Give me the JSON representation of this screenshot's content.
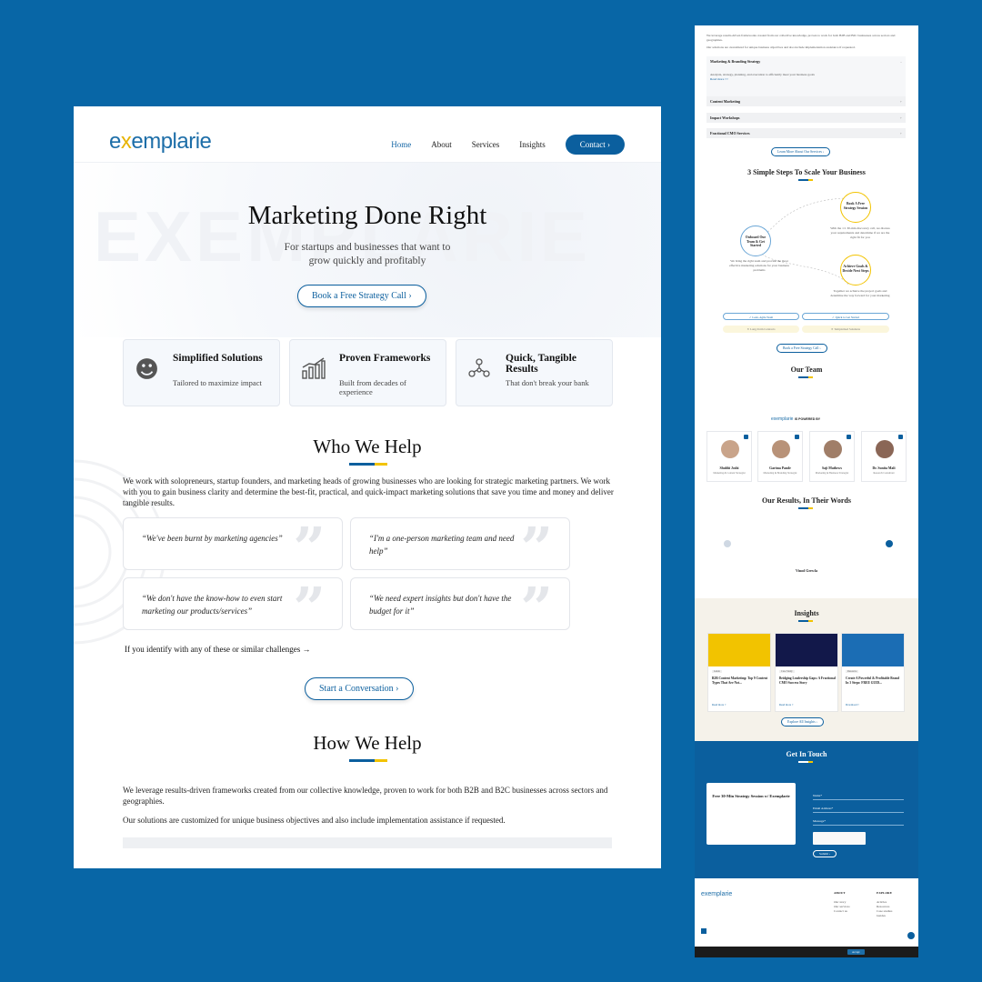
{
  "colors": {
    "background": "#0866a6",
    "brand_blue": "#0b5f9e",
    "accent_yellow": "#f2c300"
  },
  "left": {
    "logo": {
      "text_a": "e",
      "text_b": "x",
      "text_c": "emplarie"
    },
    "nav": {
      "home": "Home",
      "about": "About",
      "services": "Services",
      "insights": "Insights",
      "contact": "Contact"
    },
    "hero": {
      "title": "Marketing Done Right",
      "subtitle_1": "For startups and businesses that want to",
      "subtitle_2": "grow quickly and profitably",
      "cta": "Book a Free Strategy Call"
    },
    "features": [
      {
        "icon": "lightbulb-hand-icon",
        "title": "Simplified Solutions",
        "sub": "Tailored to maximize impact"
      },
      {
        "icon": "growth-chart-icon",
        "title": "Proven Frameworks",
        "sub": "Built from decades of experience"
      },
      {
        "icon": "target-network-icon",
        "title": "Quick, Tangible Results",
        "sub": "That don't break your bank"
      }
    ],
    "who": {
      "title": "Who We Help",
      "para": "We work with solopreneurs, startup founders, and marketing heads of growing businesses who are looking for strategic marketing partners. We work with you to gain business clarity and determine the best-fit, practical, and quick-impact marketing solutions that save you time and money and deliver tangible results.",
      "quotes": [
        "“We've been burnt by marketing agencies”",
        "“I'm a one-person marketing team and need help”",
        "“We don't have the know-how to even start marketing our products/services”",
        "“We need expert insights but don't have the budget for it”"
      ],
      "identify": "If you identify with any of these or similar challenges →",
      "cta": "Start a Conversation"
    },
    "how": {
      "title": "How We Help",
      "para_1": "We leverage results-driven frameworks created from our collective knowledge, proven to work for both B2B and B2C businesses across sectors and geographies.",
      "para_2": "Our solutions are customized for unique business objectives and also include implementation assistance if requested."
    }
  },
  "right": {
    "intro_1": "We leverage results-driven frameworks created from our collective knowledge, proven to work for both B2B and B2C businesses across sectors and geographies.",
    "intro_2": "Our solutions are customized for unique business objectives and also include implementation assistance if requested.",
    "services": [
      {
        "title": "Marketing & Branding Strategy",
        "desc": "Analysis, strategy, planning, and execution to efficiently meet your business goals",
        "more": "Read more >>"
      },
      {
        "title": "Content Marketing"
      },
      {
        "title": "Impact Workshops"
      },
      {
        "title": "Fractional CMO Services"
      }
    ],
    "services_btn": "Learn More About Our Services",
    "steps_title": "3 Simple Steps To Scale Your Business",
    "steps": [
      {
        "label": "Book A Free Strategy Session",
        "desc": "With the 1:1 30-min discovery call, we discuss your requirements and determine if we are the right fit for you"
      },
      {
        "label": "Onboard Our Team & Get Started",
        "desc": "We bring the right team and provide the most effective marketing solutions for your business problems"
      },
      {
        "label": "Achieve Goals & Decide Next Steps",
        "desc": "Together we achieve the project goals and determine the way forward for your marketing"
      }
    ],
    "pills": [
      "Lean, Agile Team",
      "Quick to Get Started",
      "Long-Term Contracts",
      "Templatized Solutions"
    ],
    "steps_btn": "Book a Free Strategy Call",
    "team_title": "Our Team",
    "powered": "IS POWERED BY",
    "team": [
      {
        "name": "Shubhi Joshi",
        "role": "Marketing & Content Strategist"
      },
      {
        "name": "Garima Pande",
        "role": "Marketing & Branding Strategist"
      },
      {
        "name": "Saji Mathews",
        "role": "Marketing & Business Strategist"
      },
      {
        "name": "Dr. Sunita Mali",
        "role": "Research Consultant"
      }
    ],
    "results_title": "Our Results, In Their Words",
    "testimonial_name": "Vinod Grewla",
    "insights_title": "Insights",
    "posts": [
      {
        "tag": "Guide",
        "title": "B2B Content Marketing: Top 9 Content Types That Are Not...",
        "more": "Read more >"
      },
      {
        "tag": "Case Study",
        "title": "Bridging Leadership Gaps: A Fractional CMO Success Story",
        "more": "Read more >"
      },
      {
        "tag": "Resource",
        "title": "Create A Powerful & Profitable Brand In 3 Steps: FREE GUID...",
        "more": "Download >"
      }
    ],
    "insights_btn": "Explore All Insights",
    "contact_title": "Get In Touch",
    "contact_card": "Free 30-Min Strategy Session w/ Exemplarie",
    "form_fields": [
      "Name*",
      "Email Address*",
      "Message*"
    ],
    "submit": "Submit",
    "footer_about": "ABOUT",
    "footer_explore": "EXPLORE",
    "footer_about_links": [
      "Our story",
      "Our services",
      "Contact us"
    ],
    "footer_explore_links": [
      "Articles",
      "Resources",
      "Case studies",
      "Guides"
    ],
    "cookie_btn": "Accept"
  }
}
